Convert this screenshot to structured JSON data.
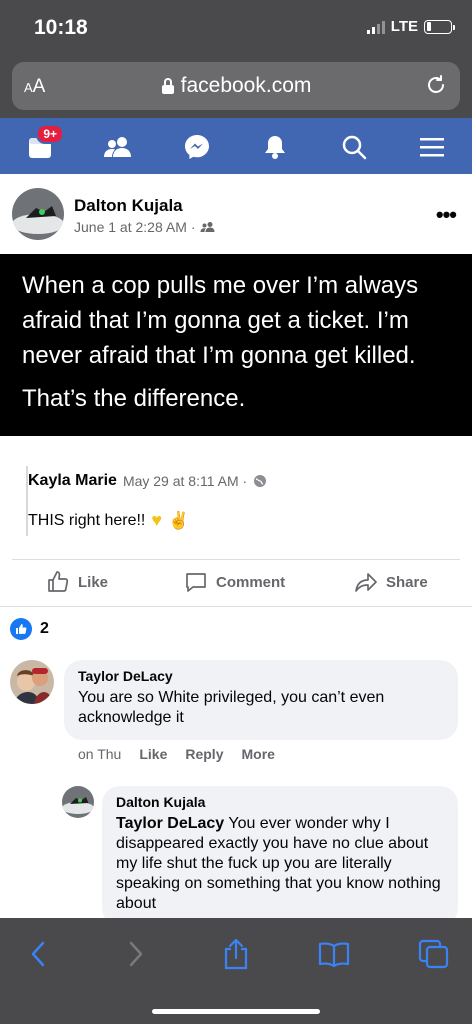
{
  "status_bar": {
    "time": "10:18",
    "network": "LTE",
    "battery_level": 0.2
  },
  "browser": {
    "text_size_button": "AA",
    "url": "facebook.com"
  },
  "fb_nav": {
    "notifications_badge": "9+"
  },
  "post": {
    "author": "Dalton Kujala",
    "timestamp": "June 1 at 2:28 AM",
    "audience_separator": "·",
    "quote_line_1": "When a cop pulls me over I’m always afraid that I’m gonna get a ticket. I’m never afraid that I’m gonna get killed.",
    "quote_line_2": "That’s the difference.",
    "shared": {
      "author": "Kayla Marie",
      "meta": "May 29 at 8:11 AM ·",
      "text": "THIS right here!!",
      "emojis": "💛✌"
    },
    "actions": {
      "like": "Like",
      "comment": "Comment",
      "share": "Share"
    },
    "reaction_count": "2"
  },
  "comments": [
    {
      "author": "Taylor DeLacy",
      "text": "You are so White privileged, you can’t even acknowledge it",
      "time": "on Thu",
      "like": "Like",
      "reply": "Reply",
      "more": "More"
    }
  ],
  "reply": {
    "author": "Dalton Kujala",
    "mention": "Taylor DeLacy",
    "text": " You ever wonder why I disappeared exactly you have no clue about my life shut the fuck up you are literally speaking on something that you know nothing about"
  },
  "colors": {
    "fb_blue": "#4267b2",
    "chrome_gray": "#4a4a4c",
    "safari_blue": "#3b82f6"
  }
}
